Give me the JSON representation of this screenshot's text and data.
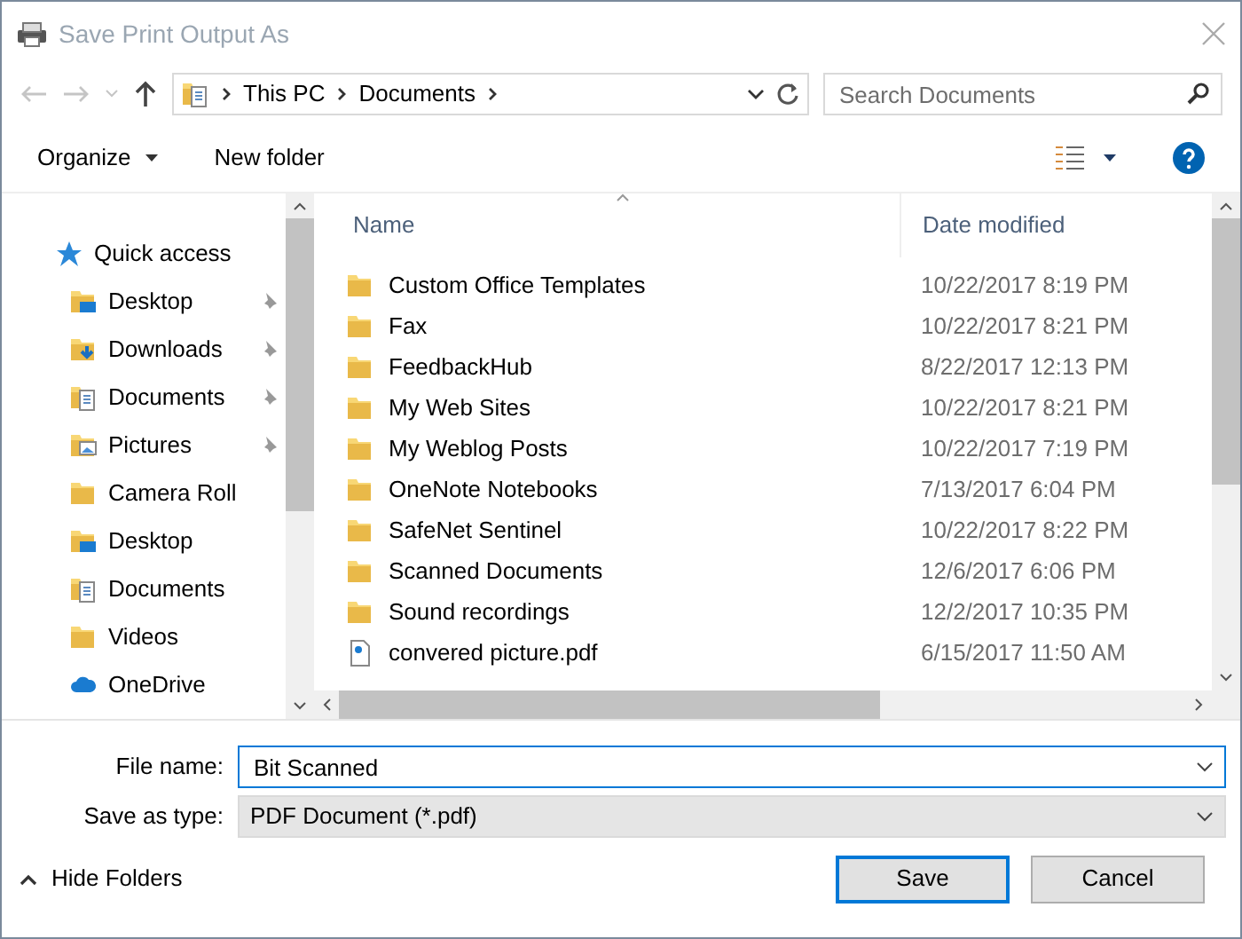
{
  "window": {
    "title": "Save Print Output As"
  },
  "address": {
    "crumbs": [
      "This PC",
      "Documents"
    ]
  },
  "search": {
    "placeholder": "Search Documents"
  },
  "toolbar": {
    "organize": "Organize",
    "new_folder": "New folder"
  },
  "sidebar": {
    "items": [
      {
        "label": "Quick access",
        "kind": "star",
        "pinned": false
      },
      {
        "label": "Desktop",
        "kind": "desktop",
        "pinned": true
      },
      {
        "label": "Downloads",
        "kind": "downloads",
        "pinned": true
      },
      {
        "label": "Documents",
        "kind": "documents",
        "pinned": true
      },
      {
        "label": "Pictures",
        "kind": "pictures",
        "pinned": true
      },
      {
        "label": "Camera Roll",
        "kind": "folder",
        "pinned": false
      },
      {
        "label": "Desktop",
        "kind": "desktop",
        "pinned": false
      },
      {
        "label": "Documents",
        "kind": "documents",
        "pinned": false
      },
      {
        "label": "Videos",
        "kind": "folder",
        "pinned": false
      },
      {
        "label": "OneDrive",
        "kind": "cloud",
        "pinned": false
      }
    ]
  },
  "table": {
    "columns": [
      "Name",
      "Date modified"
    ],
    "rows": [
      {
        "name": "Custom Office Templates",
        "date": "10/22/2017 8:19 PM",
        "kind": "folder"
      },
      {
        "name": "Fax",
        "date": "10/22/2017 8:21 PM",
        "kind": "folder"
      },
      {
        "name": "FeedbackHub",
        "date": "8/22/2017 12:13 PM",
        "kind": "folder"
      },
      {
        "name": "My Web Sites",
        "date": "10/22/2017 8:21 PM",
        "kind": "folder"
      },
      {
        "name": "My Weblog Posts",
        "date": "10/22/2017 7:19 PM",
        "kind": "folder"
      },
      {
        "name": "OneNote Notebooks",
        "date": "7/13/2017 6:04 PM",
        "kind": "folder"
      },
      {
        "name": "SafeNet Sentinel",
        "date": "10/22/2017 8:22 PM",
        "kind": "folder"
      },
      {
        "name": "Scanned Documents",
        "date": "12/6/2017 6:06 PM",
        "kind": "folder"
      },
      {
        "name": "Sound recordings",
        "date": "12/2/2017 10:35 PM",
        "kind": "folder"
      },
      {
        "name": "convered picture.pdf",
        "date": "6/15/2017 11:50 AM",
        "kind": "pdf"
      }
    ]
  },
  "form": {
    "file_name_label": "File name:",
    "file_name": "Bit Scanned",
    "type_label": "Save as type:",
    "type": "PDF Document (*.pdf)"
  },
  "footer": {
    "hide_folders": "Hide Folders",
    "buttons": [
      {
        "label": "Save",
        "default": true
      },
      {
        "label": "Cancel",
        "default": false
      }
    ]
  }
}
